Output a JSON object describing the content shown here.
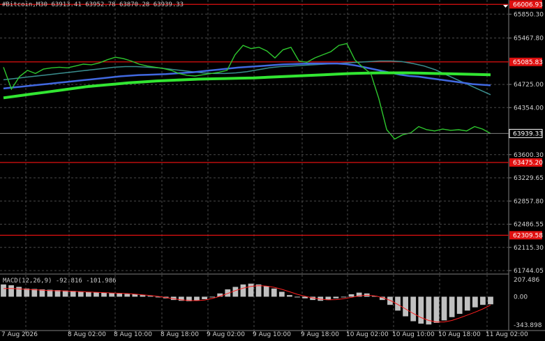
{
  "header": {
    "symbol_line": "#Bitcoin,M30  63913.41 63952.78 63870.28 63939.33",
    "macd_label": "MACD(12,26,9) -92.816 -101.986"
  },
  "colors": {
    "background": "#000000",
    "grid": "#4a4a4a",
    "axis_text": "#d0d0d0",
    "price_line": "#2ec82e",
    "sma_blue": "#4169e1",
    "sma_teal": "#3a8f8f",
    "sma_green": "#32e632",
    "level_red": "#e01010",
    "macd_hist": "#c0c0c0",
    "macd_signal": "#ff2020",
    "current_price_box": "#000000"
  },
  "chart_data": [
    {
      "type": "line",
      "title": "",
      "price_axis_ticks": [
        "65850.30",
        "65467.80",
        "64725.00",
        "64354.00",
        "63600.30",
        "63229.65",
        "62857.80",
        "62486.55",
        "62115.30",
        "61744.05"
      ],
      "price_axis_tick_values": [
        65850.3,
        65467.8,
        64725.0,
        64354.0,
        63600.3,
        63229.65,
        62857.8,
        62486.55,
        62115.3,
        61744.05
      ],
      "ylim": [
        61744.05,
        66010
      ],
      "time_ticks": [
        "7 Aug 2026",
        "8 Aug 02:00",
        "8 Aug 10:00",
        "8 Aug 18:00",
        "9 Aug 02:00",
        "9 Aug 10:00",
        "9 Aug 18:00",
        "10 Aug 02:00",
        "10 Aug 10:00",
        "10 Aug 18:00",
        "11 Aug 02:00"
      ],
      "levels": [
        {
          "label": "66006.93",
          "value": 66006.93
        },
        {
          "label": "65085.83",
          "value": 65085.83
        },
        {
          "label": "63475.20",
          "value": 63475.2
        },
        {
          "label": "62309.58",
          "value": 62309.58
        }
      ],
      "current_price": {
        "label": "63939.33",
        "value": 63939.33
      },
      "series": [
        {
          "key": "price",
          "values": [
            65000,
            64650,
            64850,
            64950,
            64900,
            64970,
            64990,
            65000,
            64990,
            65020,
            65050,
            65040,
            65070,
            65120,
            65160,
            65140,
            65100,
            65050,
            65020,
            65000,
            64980,
            64950,
            64900,
            64870,
            64860,
            64880,
            64900,
            64920,
            64950,
            65200,
            65350,
            65300,
            65320,
            65260,
            65150,
            65280,
            65320,
            65100,
            65080,
            65150,
            65200,
            65250,
            65350,
            65380,
            65120,
            65000,
            64900,
            64500,
            64000,
            63850,
            63920,
            63950,
            64050,
            64000,
            63980,
            64010,
            63990,
            64000,
            63980,
            64050,
            64010,
            63939
          ]
        },
        {
          "key": "sma_blue",
          "values": [
            64660,
            64675,
            64690,
            64705,
            64720,
            64735,
            64750,
            64765,
            64780,
            64795,
            64810,
            64825,
            64840,
            64855,
            64865,
            64875,
            64880,
            64885,
            64890,
            64900,
            64910,
            64920,
            64935,
            64950,
            64965,
            64980,
            64995,
            65005,
            65015,
            65025,
            65035,
            65045,
            65050,
            65055,
            65060,
            65060,
            65060,
            65060,
            65050,
            65030,
            65000,
            64970,
            64940,
            64910,
            64880,
            64860,
            64850,
            64830,
            64810,
            64790,
            64770,
            64750,
            64730,
            64720,
            64710
          ]
        },
        {
          "key": "sma_teal",
          "values": [
            64800,
            64820,
            64840,
            64860,
            64880,
            64900,
            64920,
            64940,
            64960,
            64980,
            65000,
            65010,
            65010,
            65000,
            64990,
            64970,
            64950,
            64930,
            64910,
            64900,
            64900,
            64910,
            64930,
            64960,
            64990,
            65010,
            65020,
            65030,
            65040,
            65050,
            65060,
            65070,
            65080,
            65090,
            65100,
            65100,
            65090,
            65060,
            65020,
            64960,
            64880,
            64800,
            64720,
            64640,
            64560
          ]
        },
        {
          "key": "sma_green",
          "values": [
            64510,
            64540,
            64570,
            64600,
            64630,
            64660,
            64690,
            64710,
            64730,
            64750,
            64765,
            64780,
            64790,
            64800,
            64810,
            64815,
            64820,
            64825,
            64830,
            64840,
            64850,
            64860,
            64870,
            64880,
            64890,
            64900,
            64905,
            64910,
            64910,
            64910,
            64905,
            64900,
            64895,
            64890,
            64885,
            64880
          ]
        }
      ]
    },
    {
      "type": "bar",
      "title": "",
      "name": "MACD(12,26,9)",
      "axis_ticks": [
        "207.486",
        "0.00",
        "-343.898"
      ],
      "axis_tick_values": [
        207.486,
        0,
        -343.898
      ],
      "ylim": [
        -380,
        260
      ],
      "series": [
        {
          "key": "histogram",
          "values": [
            150,
            140,
            120,
            100,
            95,
            90,
            85,
            80,
            75,
            70,
            65,
            60,
            55,
            50,
            45,
            40,
            35,
            30,
            20,
            10,
            0,
            -20,
            -40,
            -50,
            -55,
            -50,
            -30,
            0,
            40,
            90,
            120,
            150,
            160,
            150,
            130,
            100,
            60,
            20,
            0,
            -20,
            -40,
            -50,
            -40,
            -20,
            0,
            30,
            50,
            40,
            10,
            -40,
            -100,
            -170,
            -240,
            -300,
            -330,
            -340,
            -320,
            -290,
            -250,
            -210,
            -170,
            -130,
            -100,
            -93
          ]
        },
        {
          "key": "signal",
          "values": [
            100,
            100,
            95,
            90,
            85,
            80,
            75,
            72,
            70,
            66,
            62,
            58,
            54,
            50,
            46,
            42,
            38,
            32,
            24,
            14,
            4,
            -10,
            -25,
            -38,
            -46,
            -48,
            -40,
            -22,
            5,
            40,
            75,
            105,
            125,
            135,
            130,
            115,
            90,
            60,
            30,
            5,
            -15,
            -30,
            -38,
            -35,
            -25,
            -8,
            10,
            18,
            10,
            -10,
            -45,
            -95,
            -150,
            -205,
            -255,
            -290,
            -310,
            -310,
            -290,
            -260,
            -225,
            -190,
            -150,
            -102
          ]
        }
      ]
    }
  ]
}
